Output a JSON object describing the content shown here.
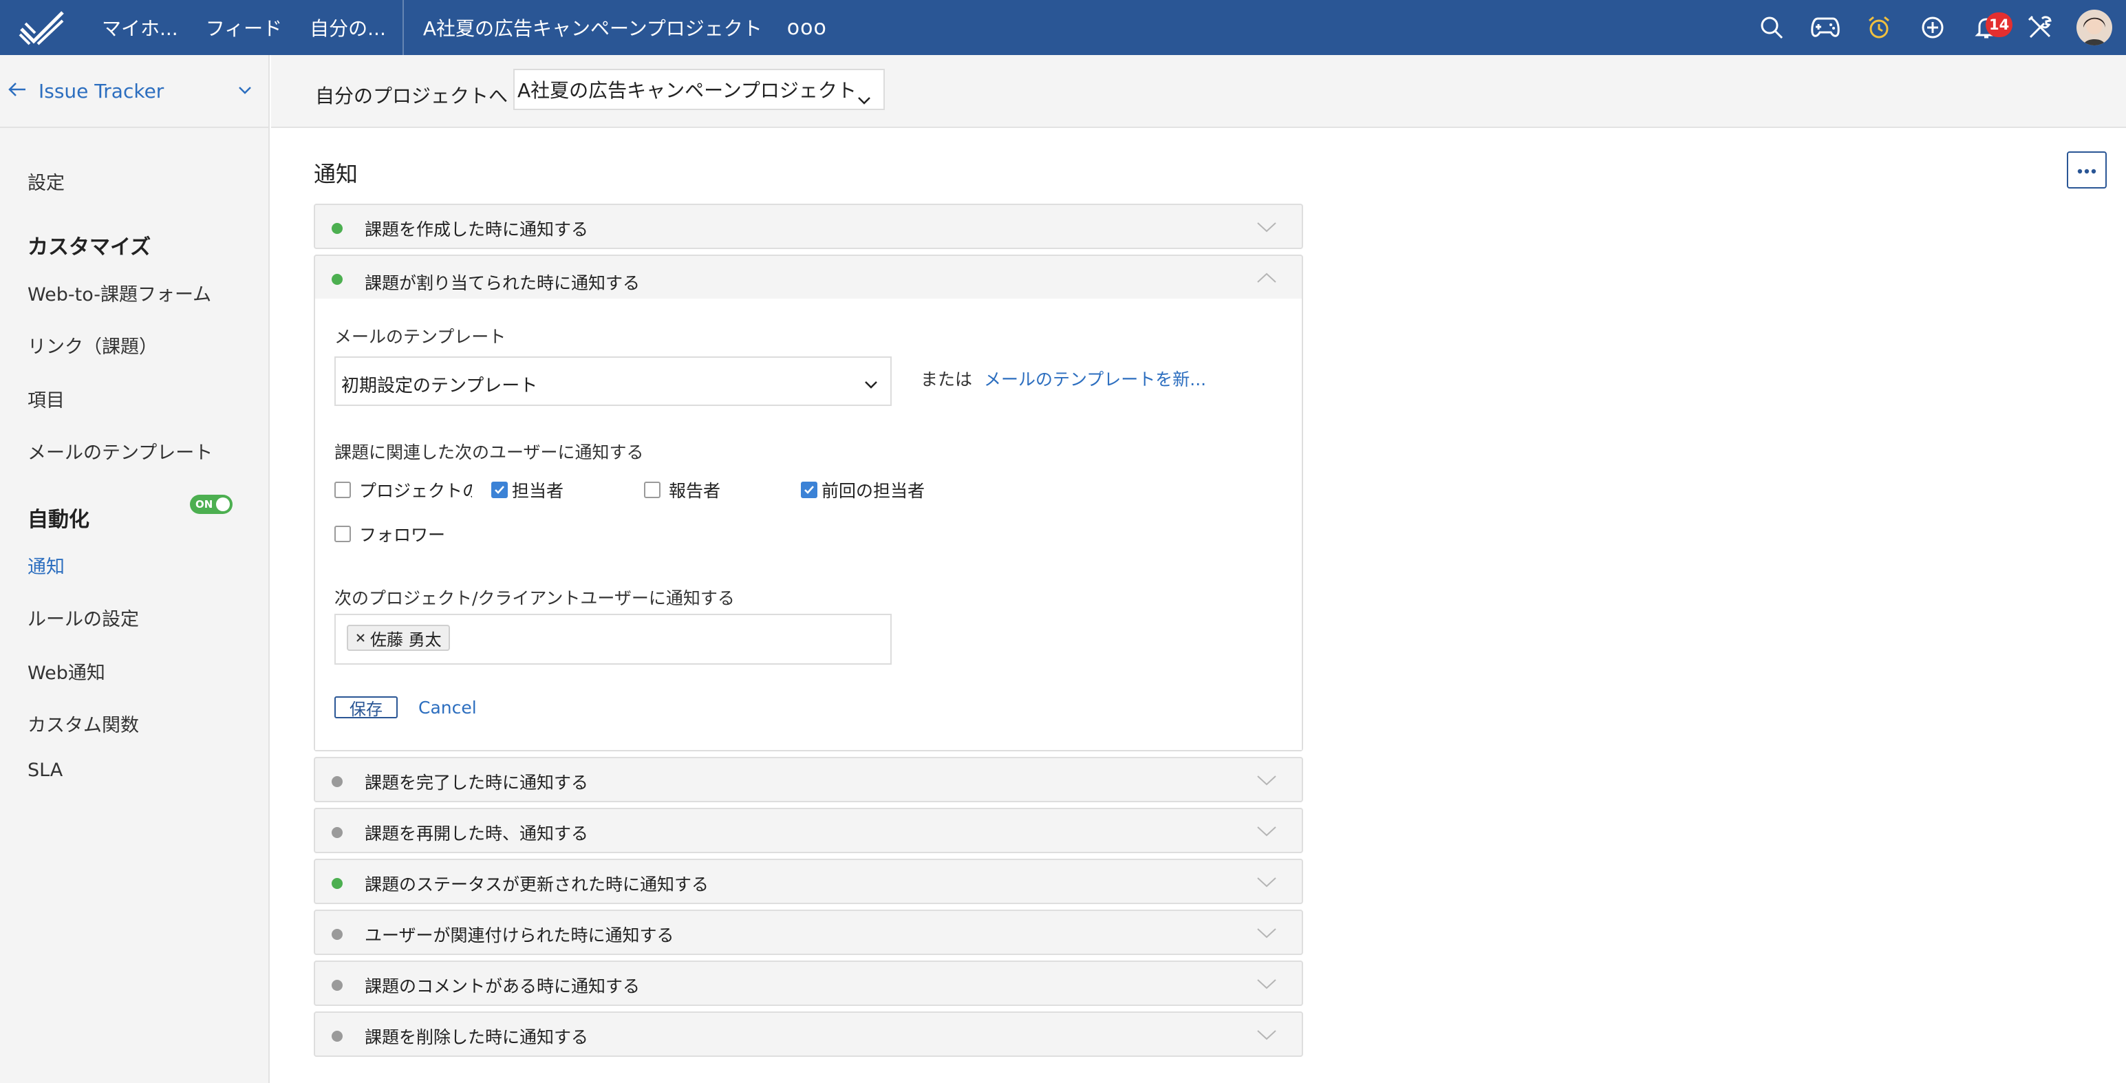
{
  "topbar": {
    "nav": [
      "マイホ...",
      "フィード",
      "自分の..."
    ],
    "project": "A社夏の広告キャンペーンプロジェクト",
    "more": "ooo",
    "notification_count": "14"
  },
  "sidebar": {
    "title": "Issue Tracker",
    "settings": "設定",
    "customize_heading": "カスタマイズ",
    "customize_items": [
      "Web-to-課題フォーム",
      "リンク（課題）",
      "項目",
      "メールのテンプレート"
    ],
    "automation_heading": "自動化",
    "notification": "通知",
    "toggle_label": "ON",
    "automation_items": [
      "ルールの設定",
      "Web通知",
      "カスタム関数",
      "SLA"
    ]
  },
  "projbar": {
    "label": "自分のプロジェクトへ",
    "selected": "A社夏の広告キャンペーンプロジェクト"
  },
  "main": {
    "title": "通知",
    "accordions_top": [
      {
        "label": "課題を作成した時に通知する",
        "status": "green"
      }
    ],
    "expanded": {
      "label": "課題が割り当てられた時に通知する",
      "status": "green",
      "template_label": "メールのテンプレート",
      "template_value": "初期設定のテンプレート",
      "or_text": "または",
      "new_template_link": "メールのテンプレートを新...",
      "notify_users_label": "課題に関連した次のユーザーに通知する",
      "checkboxes": [
        {
          "label": "プロジェクトの",
          "checked": false
        },
        {
          "label": "担当者",
          "checked": true
        },
        {
          "label": "報告者",
          "checked": false
        },
        {
          "label": "前回の担当者",
          "checked": true
        },
        {
          "label": "フォロワー",
          "checked": false
        }
      ],
      "client_users_label": "次のプロジェクト/クライアントユーザーに通知する",
      "chip": "佐藤 勇太",
      "save": "保存",
      "cancel": "Cancel"
    },
    "accordions_bottom": [
      {
        "label": "課題を完了した時に通知する",
        "status": "gray"
      },
      {
        "label": "課題を再開した時、通知する",
        "status": "gray"
      },
      {
        "label": "課題のステータスが更新された時に通知する",
        "status": "green"
      },
      {
        "label": "ユーザーが関連付けられた時に通知する",
        "status": "gray"
      },
      {
        "label": "課題のコメントがある時に通知する",
        "status": "gray"
      },
      {
        "label": "課題を削除した時に通知する",
        "status": "gray"
      }
    ]
  },
  "colors": {
    "topbar": "#2a5695",
    "link": "#2c6ebf",
    "status_green": "#4caf50",
    "status_gray": "#9a9a9a",
    "checkbox_checked": "#3b82d6",
    "badge": "#e32f2f"
  }
}
